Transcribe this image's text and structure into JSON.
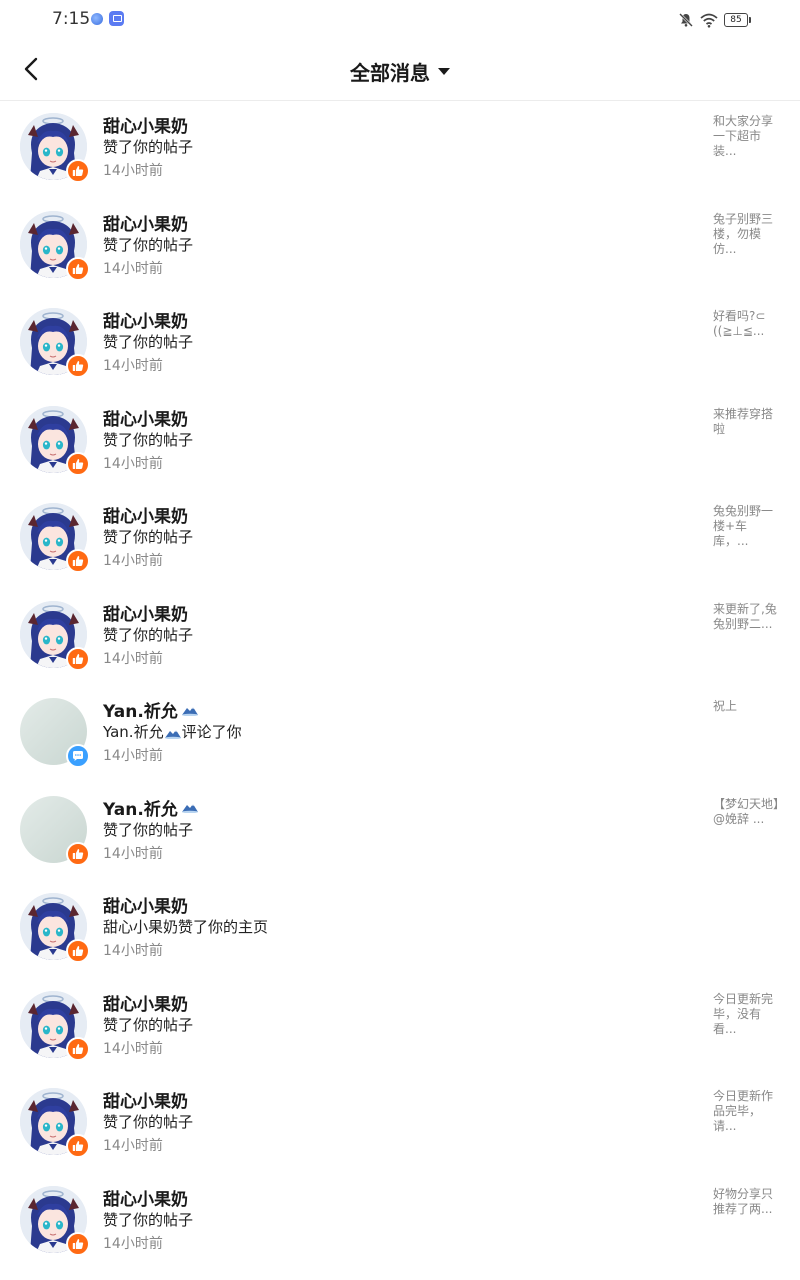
{
  "status": {
    "time": "7:15",
    "battery": "85"
  },
  "header": {
    "title": "全部消息"
  },
  "messages": [
    {
      "name": "甜心小果奶",
      "action": "赞了你的帖子",
      "time": "14小时前",
      "preview": "和大家分享一下超市装...",
      "avatar": "anime",
      "badge": "like"
    },
    {
      "name": "甜心小果奶",
      "action": "赞了你的帖子",
      "time": "14小时前",
      "preview": "兔子别野三楼，勿模仿...",
      "avatar": "anime",
      "badge": "like"
    },
    {
      "name": "甜心小果奶",
      "action": "赞了你的帖子",
      "time": "14小时前",
      "preview": "好看吗?⊂((≧⊥≦...",
      "avatar": "anime",
      "badge": "like"
    },
    {
      "name": "甜心小果奶",
      "action": "赞了你的帖子",
      "time": "14小时前",
      "preview": "来推荐穿搭啦",
      "avatar": "anime",
      "badge": "like"
    },
    {
      "name": "甜心小果奶",
      "action": "赞了你的帖子",
      "time": "14小时前",
      "preview": "兔兔别野一楼+车库，...",
      "avatar": "anime",
      "badge": "like"
    },
    {
      "name": "甜心小果奶",
      "action": "赞了你的帖子",
      "time": "14小时前",
      "preview": "来更新了,兔兔别野二...",
      "avatar": "anime",
      "badge": "like"
    },
    {
      "name": "Yan.祈允",
      "action": "Yan.祈允评论了你",
      "time": "14小时前",
      "preview": "祝上",
      "avatar": "plain",
      "badge": "comment"
    },
    {
      "name": "Yan.祈允",
      "action": "赞了你的帖子",
      "time": "14小时前",
      "preview": "【梦幻天地】@娩辞 ...",
      "avatar": "plain",
      "badge": "like"
    },
    {
      "name": "甜心小果奶",
      "action": "甜心小果奶赞了你的主页",
      "time": "14小时前",
      "preview": "",
      "avatar": "anime",
      "badge": "like"
    },
    {
      "name": "甜心小果奶",
      "action": "赞了你的帖子",
      "time": "14小时前",
      "preview": "今日更新完毕，没有看...",
      "avatar": "anime",
      "badge": "like"
    },
    {
      "name": "甜心小果奶",
      "action": "赞了你的帖子",
      "time": "14小时前",
      "preview": "今日更新作品完毕，请...",
      "avatar": "anime",
      "badge": "like"
    },
    {
      "name": "甜心小果奶",
      "action": "赞了你的帖子",
      "time": "14小时前",
      "preview": "好物分享只推荐了两...",
      "avatar": "anime",
      "badge": "like"
    }
  ]
}
